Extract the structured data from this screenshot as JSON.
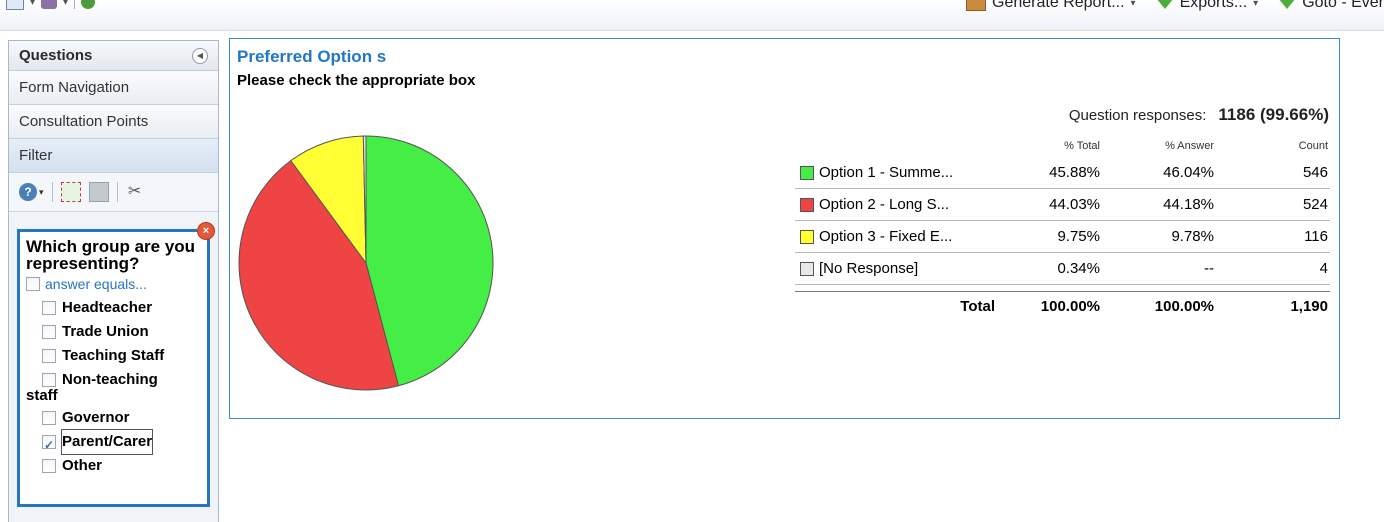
{
  "toolbar": {
    "generate_report": "Generate Report...",
    "exports": "Exports...",
    "goto": "Goto - Ever"
  },
  "sidebar": {
    "title": "Questions",
    "items": [
      {
        "label": "Form Navigation"
      },
      {
        "label": "Consultation Points"
      }
    ],
    "filter_label": "Filter",
    "filter_box": {
      "question": "Which group are you representing?",
      "answer_equals": "answer equals...",
      "options": [
        {
          "label": "Headteacher",
          "checked": false
        },
        {
          "label": "Trade Union",
          "checked": false
        },
        {
          "label": "Teaching Staff",
          "checked": false
        },
        {
          "label": "Non-teaching",
          "label2": "staff",
          "checked": false
        },
        {
          "label": "Governor",
          "checked": false
        },
        {
          "label": "Parent/Carer",
          "checked": true
        },
        {
          "label": "Other",
          "checked": false
        }
      ]
    }
  },
  "main": {
    "title": "Preferred Option s",
    "subtitle": "Please check the appropriate box",
    "responses_label": "Question responses:",
    "responses_value": "1186 (99.66%)",
    "table": {
      "headers": {
        "total": "% Total",
        "answer": "% Answer",
        "count": "Count"
      },
      "rows": [
        {
          "name": "Option 1 - Summe...",
          "total": "45.88%",
          "answer": "46.04%",
          "count": "546",
          "color": "#44ee44"
        },
        {
          "name": "Option 2 - Long S...",
          "total": "44.03%",
          "answer": "44.18%",
          "count": "524",
          "color": "#ee4444"
        },
        {
          "name": "Option 3 - Fixed E...",
          "total": "9.75%",
          "answer": "9.78%",
          "count": "116",
          "color": "#ffff33"
        },
        {
          "name": "[No Response]",
          "total": "0.34%",
          "answer": "--",
          "count": "4",
          "color": "#e8e8e8"
        }
      ],
      "total_row": {
        "label": "Total",
        "total": "100.00%",
        "answer": "100.00%",
        "count": "1,190"
      }
    }
  },
  "chart_data": {
    "type": "pie",
    "categories": [
      "Option 1 - Summe...",
      "Option 2 - Long S...",
      "Option 3 - Fixed E...",
      "[No Response]"
    ],
    "values": [
      546,
      524,
      116,
      4
    ],
    "colors": [
      "#44ee44",
      "#ee4444",
      "#ffff33",
      "#e8e8e8"
    ]
  }
}
